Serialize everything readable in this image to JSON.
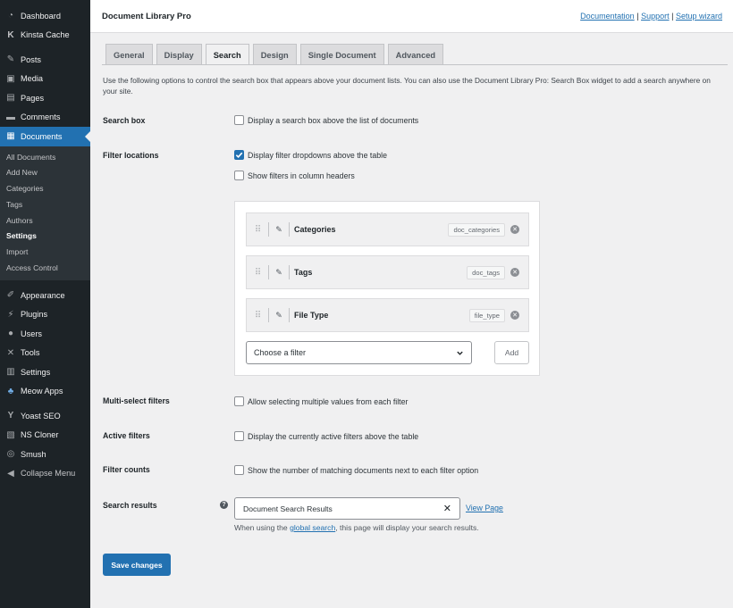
{
  "sidebar": {
    "top_items": [
      {
        "label": "Dashboard",
        "icon": "dashboard-icon"
      },
      {
        "label": "Kinsta Cache",
        "icon": "kinsta-icon"
      }
    ],
    "main_items": [
      {
        "label": "Posts",
        "icon": "pin-icon"
      },
      {
        "label": "Media",
        "icon": "media-icon"
      },
      {
        "label": "Pages",
        "icon": "pages-icon"
      },
      {
        "label": "Comments",
        "icon": "comments-icon"
      }
    ],
    "active_item": {
      "label": "Documents",
      "icon": "document-icon"
    },
    "submenu": [
      "All Documents",
      "Add New",
      "Categories",
      "Tags",
      "Authors",
      "Settings",
      "Import",
      "Access Control"
    ],
    "current_submenu": "Settings",
    "lower_items": [
      {
        "label": "Appearance",
        "icon": "appearance-icon"
      },
      {
        "label": "Plugins",
        "icon": "plugins-icon"
      },
      {
        "label": "Users",
        "icon": "users-icon"
      },
      {
        "label": "Tools",
        "icon": "tools-icon"
      },
      {
        "label": "Settings",
        "icon": "settings-icon"
      },
      {
        "label": "Meow Apps",
        "icon": "meow-icon"
      }
    ],
    "bottom_items": [
      {
        "label": "Yoast SEO",
        "icon": "yoast-icon"
      },
      {
        "label": "NS Cloner",
        "icon": "cloner-icon"
      },
      {
        "label": "Smush",
        "icon": "smush-icon"
      },
      {
        "label": "Collapse Menu",
        "icon": "collapse-icon"
      }
    ]
  },
  "header": {
    "title": "Document Library Pro",
    "links": [
      "Documentation",
      "Support",
      "Setup wizard"
    ],
    "separator": "|"
  },
  "tabs": [
    "General",
    "Display",
    "Search",
    "Design",
    "Single Document",
    "Advanced"
  ],
  "active_tab": "Search",
  "intro": "Use the following options to control the search box that appears above your document lists. You can also use the Document Library Pro: Search Box widget to add a search anywhere on your site.",
  "settings": {
    "search_box": {
      "label": "Search box",
      "option": "Display a search box above the list of documents",
      "checked": false
    },
    "filter_locations": {
      "label": "Filter locations",
      "options": [
        {
          "text": "Display filter dropdowns above the table",
          "checked": true
        },
        {
          "text": "Show filters in column headers",
          "checked": false
        }
      ]
    },
    "filters": [
      {
        "name": "Categories",
        "slug": "doc_categories"
      },
      {
        "name": "Tags",
        "slug": "doc_tags"
      },
      {
        "name": "File Type",
        "slug": "file_type"
      }
    ],
    "filter_select": {
      "value": "Choose a filter"
    },
    "add_label": "Add",
    "multi_select": {
      "label": "Multi-select filters",
      "option": "Allow selecting multiple values from each filter",
      "checked": false
    },
    "active_filters": {
      "label": "Active filters",
      "option": "Display the currently active filters above the table",
      "checked": false
    },
    "filter_counts": {
      "label": "Filter counts",
      "option": "Show the number of matching documents next to each filter option",
      "checked": false
    },
    "search_results": {
      "label": "Search results",
      "help_glyph": "?",
      "value": "Document Search Results",
      "view_page": "View Page",
      "note_before": "When using the ",
      "note_link": "global search",
      "note_after": ", this page will display your search results."
    }
  },
  "save_label": "Save changes",
  "colors": {
    "sidebar_bg": "#1d2327",
    "accent": "#2271b1",
    "page_bg": "#f0f0f1"
  }
}
